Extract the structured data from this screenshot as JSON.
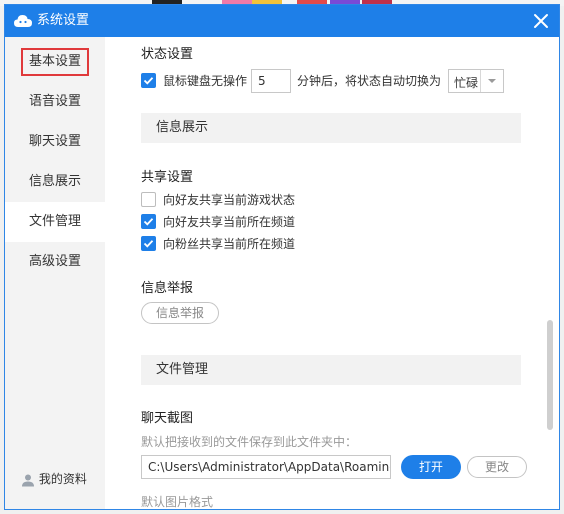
{
  "window": {
    "title": "系统设置",
    "accent": "#1e7fe8",
    "close_icon": "close-icon",
    "logo_icon": "cloud-logo-icon"
  },
  "sidebar": {
    "items": [
      {
        "label": "基本设置"
      },
      {
        "label": "语音设置"
      },
      {
        "label": "聊天设置"
      },
      {
        "label": "信息展示"
      },
      {
        "label": "文件管理"
      },
      {
        "label": "高级设置"
      }
    ],
    "active_index": 4,
    "highlighted_index": 0,
    "profile_label": "我的资料",
    "profile_icon": "user-icon"
  },
  "status_settings": {
    "title": "状态设置",
    "idle_checkbox_label": "鼠标键盘无操作",
    "idle_checked": true,
    "idle_minutes": "5",
    "after_text": "分钟后，将状态自动切换为",
    "status_value": "忙碌"
  },
  "info_display": {
    "title": "信息展示"
  },
  "share_settings": {
    "title": "共享设置",
    "options": [
      {
        "label": "向好友共享当前游戏状态",
        "checked": false
      },
      {
        "label": "向好友共享当前所在频道",
        "checked": true
      },
      {
        "label": "向粉丝共享当前所在频道",
        "checked": true
      }
    ]
  },
  "report": {
    "title": "信息举报",
    "button_label": "信息举报"
  },
  "file_management": {
    "title": "文件管理",
    "chat_screenshot_title": "聊天截图",
    "save_hint": "默认把接收到的文件保存到此文件夹中：",
    "path_value": "C:\\Users\\Administrator\\AppData\\Roaming",
    "open_label": "打开",
    "change_label": "更改",
    "image_format_label": "默认图片格式"
  }
}
